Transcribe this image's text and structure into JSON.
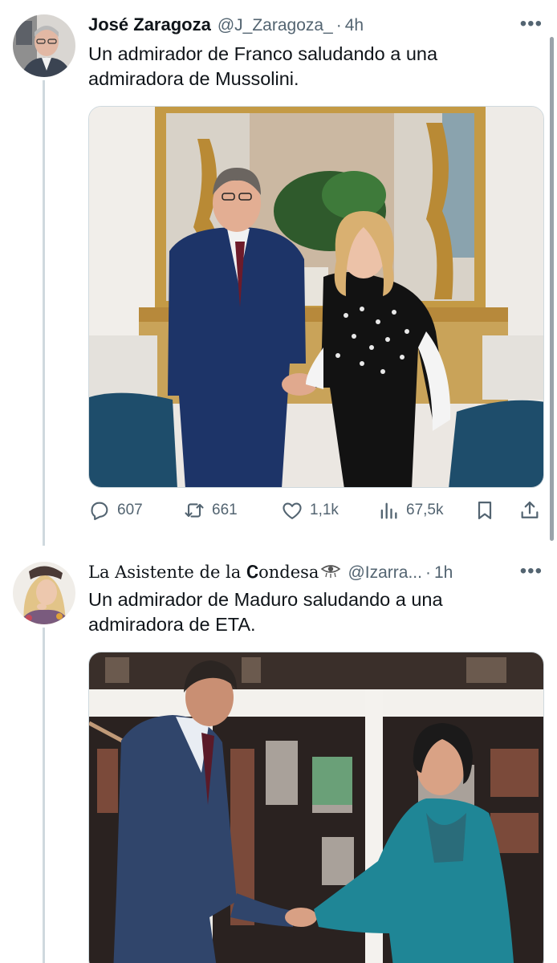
{
  "tweets": [
    {
      "author_name": "José Zaragoza",
      "handle": "@J_Zaragoza_",
      "separator": "·",
      "time": "4h",
      "more_label": "•••",
      "text_line1": "Un admirador de Franco saludando a una",
      "text_line2": "admiradora de Mussolini.",
      "actions": {
        "replies": "607",
        "retweets": "661",
        "likes": "1,1k",
        "views": "67,5k"
      }
    },
    {
      "author_name": "La Asistente de la 𝐂ondesa",
      "handle": "@Izarra...",
      "separator": "·",
      "time": "1h",
      "more_label": "•••",
      "text_line1": "Un admirador de Maduro saludando a una",
      "text_line2": "admiradora de ETA."
    }
  ],
  "icons": [
    "reply-icon",
    "retweet-icon",
    "like-icon",
    "views-icon",
    "bookmark-icon",
    "share-icon",
    "more-icon",
    "eye-emoji-icon"
  ],
  "colors": {
    "text": "#0f1419",
    "secondary": "#536471",
    "thread_line": "#cfd9de"
  }
}
